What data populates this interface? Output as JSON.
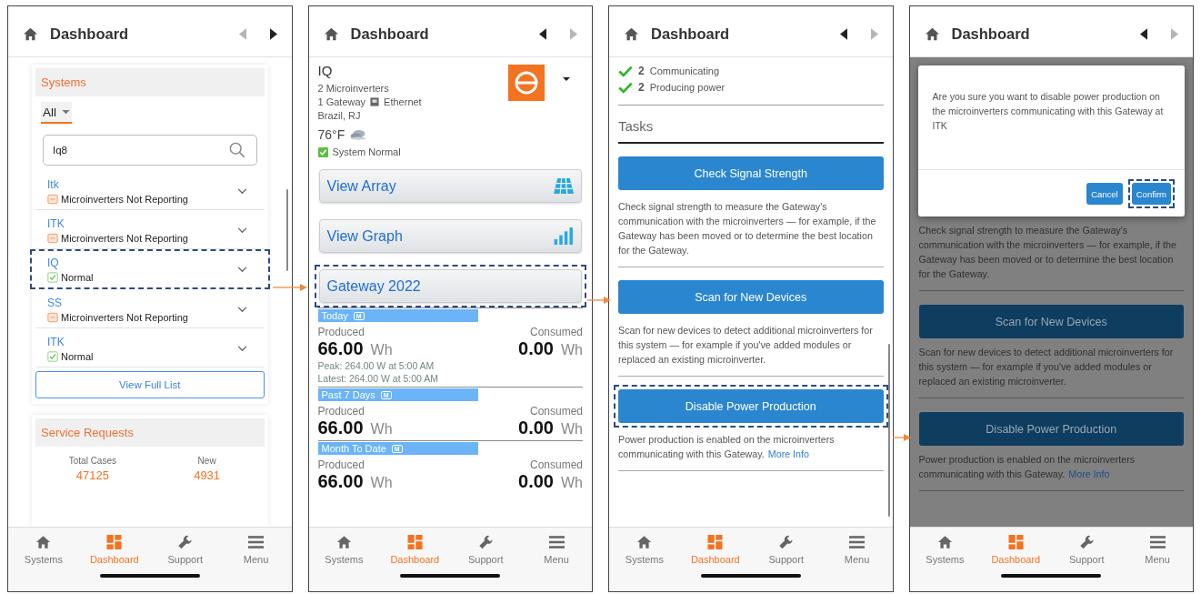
{
  "screens": [
    {
      "kind": "systems_list",
      "header": {
        "title": "Dashboard",
        "back_disabled": true,
        "forward_disabled": false
      },
      "systems_card": {
        "title": "Systems",
        "filter": "All",
        "search": {
          "value": "Iq8"
        },
        "items": [
          {
            "name": "Itk",
            "status": "Microinverters Not Reporting",
            "kind": "warning",
            "highlighted": false
          },
          {
            "name": "ITK",
            "status": "Microinverters Not Reporting",
            "kind": "warning",
            "highlighted": false
          },
          {
            "name": "IQ",
            "status": "Normal",
            "kind": "normal",
            "highlighted": true
          },
          {
            "name": "SS",
            "status": "Microinverters Not Reporting",
            "kind": "warning",
            "highlighted": false
          },
          {
            "name": "ITK",
            "status": "Normal",
            "kind": "normal",
            "highlighted": false
          }
        ],
        "button": "View Full List"
      },
      "service_card": {
        "title": "Service Requests",
        "stats": [
          {
            "label": "Total Cases",
            "value": "47125"
          },
          {
            "label": "New",
            "value": "4931"
          }
        ]
      },
      "tabs": [
        {
          "label": "Systems",
          "selected": false
        },
        {
          "label": "Dashboard",
          "selected": true
        },
        {
          "label": "Support",
          "selected": false
        },
        {
          "label": "Menu",
          "selected": false
        }
      ]
    },
    {
      "kind": "system_detail",
      "header": {
        "title": "Dashboard",
        "back_disabled": false,
        "forward_disabled": true
      },
      "system": {
        "name": "IQ",
        "microinverters": "2 Microinverters",
        "gateway": "1 Gateway",
        "connection": "Ethernet",
        "location": "Brazil, RJ",
        "temperature": "76°F",
        "status": "System Normal"
      },
      "actions": [
        {
          "label": "View Array",
          "highlighted": false
        },
        {
          "label": "View Graph",
          "highlighted": false
        },
        {
          "label": "Gateway 2022",
          "highlighted": true
        }
      ],
      "periods": [
        {
          "label": "Today",
          "badge": "M",
          "produced_label": "Produced",
          "produced": "66.00",
          "produced_unit": "Wh",
          "consumed_label": "Consumed",
          "consumed": "0.00",
          "consumed_unit": "Wh",
          "details": [
            "Peak: 264.00  W at 5:00 AM",
            "Latest: 264.00  W at 5:00 AM"
          ]
        },
        {
          "label": "Past 7 Days",
          "badge": "M",
          "produced_label": "Produced",
          "produced": "66.00",
          "produced_unit": "Wh",
          "consumed_label": "Consumed",
          "consumed": "0.00",
          "consumed_unit": "Wh"
        },
        {
          "label": "Month To Date",
          "badge": "M",
          "produced_label": "Produced",
          "produced": "66.00",
          "produced_unit": "Wh",
          "consumed_label": "Consumed",
          "consumed": "0.00",
          "consumed_unit": "Wh"
        }
      ],
      "tabs": [
        {
          "label": "Systems",
          "selected": false
        },
        {
          "label": "Dashboard",
          "selected": true
        },
        {
          "label": "Support",
          "selected": false
        },
        {
          "label": "Menu",
          "selected": false
        }
      ]
    },
    {
      "kind": "gateway_tasks",
      "header": {
        "title": "Dashboard",
        "back_disabled": false,
        "forward_disabled": true
      },
      "checks": [
        {
          "count": "2",
          "label": "Communicating"
        },
        {
          "count": "2",
          "label": "Producing power"
        }
      ],
      "section_title": "Tasks",
      "tasks": [
        {
          "button": "Check Signal Strength",
          "description": "Check signal strength to measure the Gateway's communication with the microinverters — for example, if the Gateway has been moved or to determine the best location for the Gateway.",
          "highlighted": false
        },
        {
          "button": "Scan for New Devices",
          "description": "Scan for new devices to detect additional microinverters for this system — for example if you've added modules or replaced an existing microinverter.",
          "highlighted": false
        },
        {
          "button": "Disable Power Production",
          "description": "Power production is enabled on the microinverters communicating with this Gateway.",
          "link": "More Info",
          "highlighted": true
        }
      ],
      "tabs": [
        {
          "label": "Systems",
          "selected": false
        },
        {
          "label": "Dashboard",
          "selected": true
        },
        {
          "label": "Support",
          "selected": false
        },
        {
          "label": "Menu",
          "selected": false
        }
      ]
    },
    {
      "kind": "confirm_dialog",
      "header": {
        "title": "Dashboard",
        "back_disabled": false,
        "forward_disabled": true
      },
      "dialog": {
        "message": "Are you sure you want to disable power production on the microinverters communicating with this Gateway at ITK",
        "buttons": [
          {
            "label": "Cancel",
            "highlighted": false
          },
          {
            "label": "Confirm",
            "highlighted": true
          }
        ]
      },
      "tasks": [
        {
          "description": "Check signal strength to measure the Gateway's communication with the microinverters — for example, if the Gateway has been moved or to determine the best location for the Gateway."
        },
        {
          "button": "Scan for New Devices",
          "description": "Scan for new devices to detect additional microinverters for this system — for example if you've added modules or replaced an existing microinverter."
        },
        {
          "button": "Disable Power Production",
          "description": "Power production is enabled on the microinverters communicating with this Gateway.",
          "link": "More Info"
        }
      ],
      "tabs": [
        {
          "label": "Systems",
          "selected": false
        },
        {
          "label": "Dashboard",
          "selected": true
        },
        {
          "label": "Support",
          "selected": false
        },
        {
          "label": "Menu",
          "selected": false
        }
      ]
    }
  ]
}
